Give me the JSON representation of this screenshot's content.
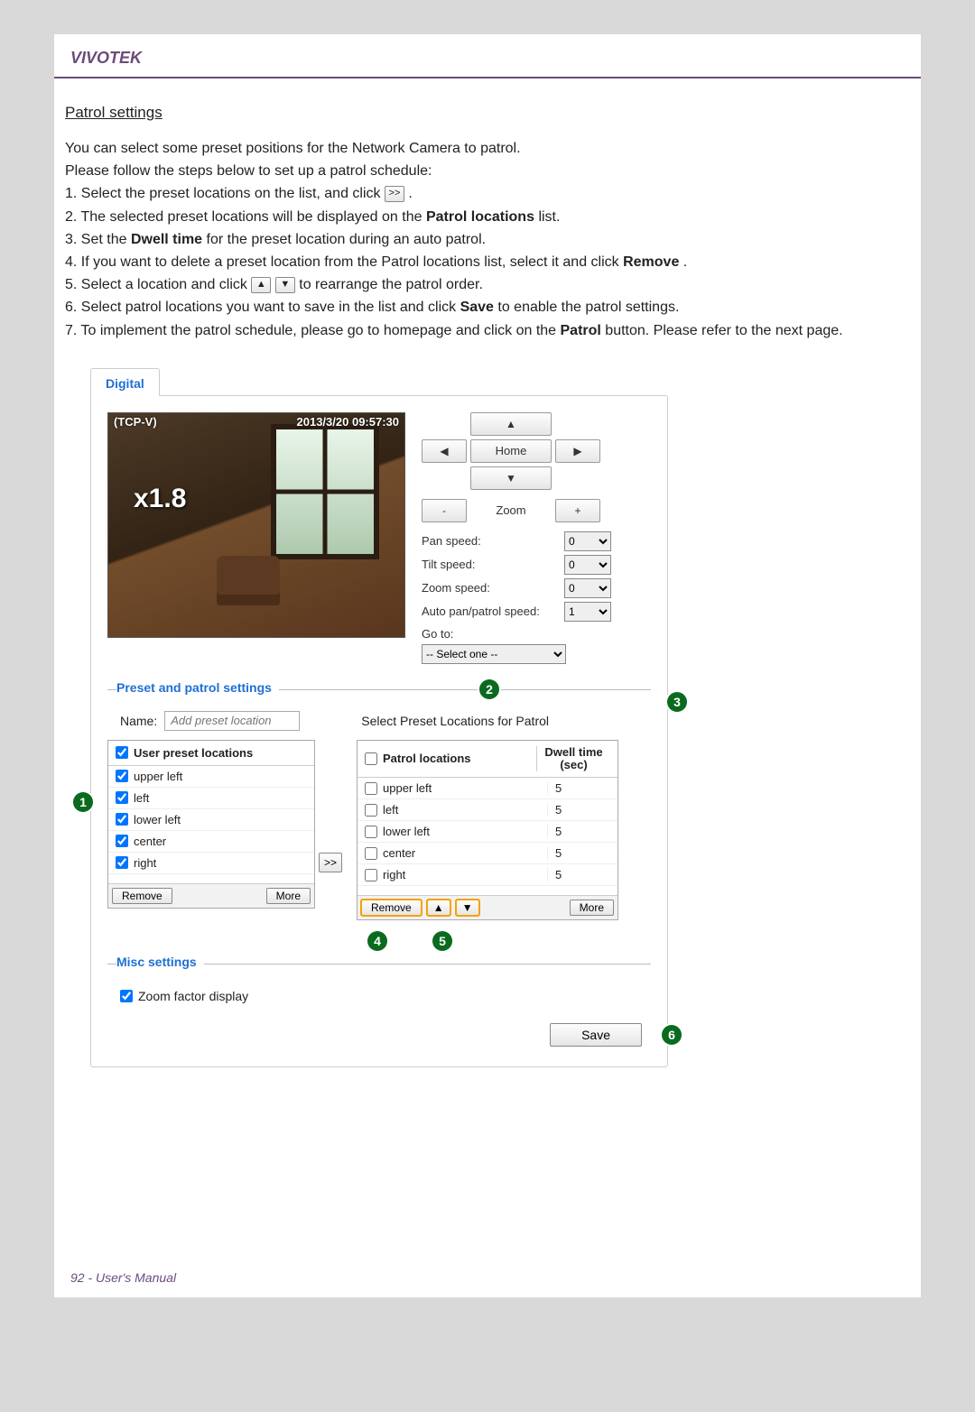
{
  "header": {
    "brand": "VIVOTEK"
  },
  "section_title": "Patrol settings",
  "intro": [
    "You can select some preset positions for the Network Camera to patrol.",
    "Please follow the steps below to set up a patrol schedule:"
  ],
  "steps": {
    "s1a": "1. Select the preset locations on the list, and click ",
    "s1b": ".",
    "s2a": "2. The selected preset locations will be displayed on the ",
    "s2b": "Patrol locations",
    "s2c": " list.",
    "s3a": "3. Set the ",
    "s3b": "Dwell time",
    "s3c": " for the preset location during an auto patrol.",
    "s4a": "4. If you want to delete a preset location from the Patrol locations list, select it and click ",
    "s4b": "Remove",
    "s4c": ".",
    "s5a": "5. Select a location and click ",
    "s5b": " to rearrange the patrol order.",
    "s6a": "6. Select patrol locations you want to save in the list and click ",
    "s6b": "Save",
    "s6c": " to enable the patrol settings.",
    "s7a": "7. To implement the patrol schedule, please go to homepage and click on the ",
    "s7b": "Patrol",
    "s7c": " button. Please refer to the next page."
  },
  "inline_btn": {
    "transfer": ">>",
    "up": "▲",
    "down": "▼"
  },
  "tab": {
    "label": "Digital"
  },
  "camera": {
    "source": "(TCP-V)",
    "timestamp": "2013/3/20 09:57:30",
    "zoom_factor": "x1.8"
  },
  "ptz": {
    "home": "Home",
    "zoom": "Zoom",
    "pan_speed_label": "Pan speed:",
    "tilt_speed_label": "Tilt speed:",
    "zoom_speed_label": "Zoom speed:",
    "auto_speed_label": "Auto pan/patrol speed:",
    "pan_speed": "0",
    "tilt_speed": "0",
    "zoom_speed": "0",
    "auto_speed": "1",
    "goto_label": "Go to:",
    "goto_value": "-- Select one --",
    "arrows": {
      "up": "▲",
      "down": "▼",
      "left": "◀",
      "right": "▶",
      "minus": "-",
      "plus": "+"
    }
  },
  "preset": {
    "legend": "Preset and patrol settings",
    "name_label": "Name:",
    "name_placeholder": "Add preset location",
    "select_label": "Select Preset Locations for Patrol",
    "left_header": "User preset locations",
    "right_header": "Patrol locations",
    "dwell_header1": "Dwell time",
    "dwell_header2": "(sec)",
    "left_items": [
      {
        "name": "upper left",
        "checked": true
      },
      {
        "name": "left",
        "checked": true
      },
      {
        "name": "lower left",
        "checked": true
      },
      {
        "name": "center",
        "checked": true
      },
      {
        "name": "right",
        "checked": true
      }
    ],
    "right_items": [
      {
        "name": "upper left",
        "dwell": "5"
      },
      {
        "name": "left",
        "dwell": "5"
      },
      {
        "name": "lower left",
        "dwell": "5"
      },
      {
        "name": "center",
        "dwell": "5"
      },
      {
        "name": "right",
        "dwell": "5"
      }
    ],
    "remove": "Remove",
    "more": "More",
    "transfer": ">>"
  },
  "misc": {
    "legend": "Misc settings",
    "zoom_factor_display": "Zoom factor display"
  },
  "save": "Save",
  "callouts": {
    "c1": "1",
    "c2": "2",
    "c3": "3",
    "c4": "4",
    "c5": "5",
    "c6": "6"
  },
  "footer": "92 - User's Manual"
}
